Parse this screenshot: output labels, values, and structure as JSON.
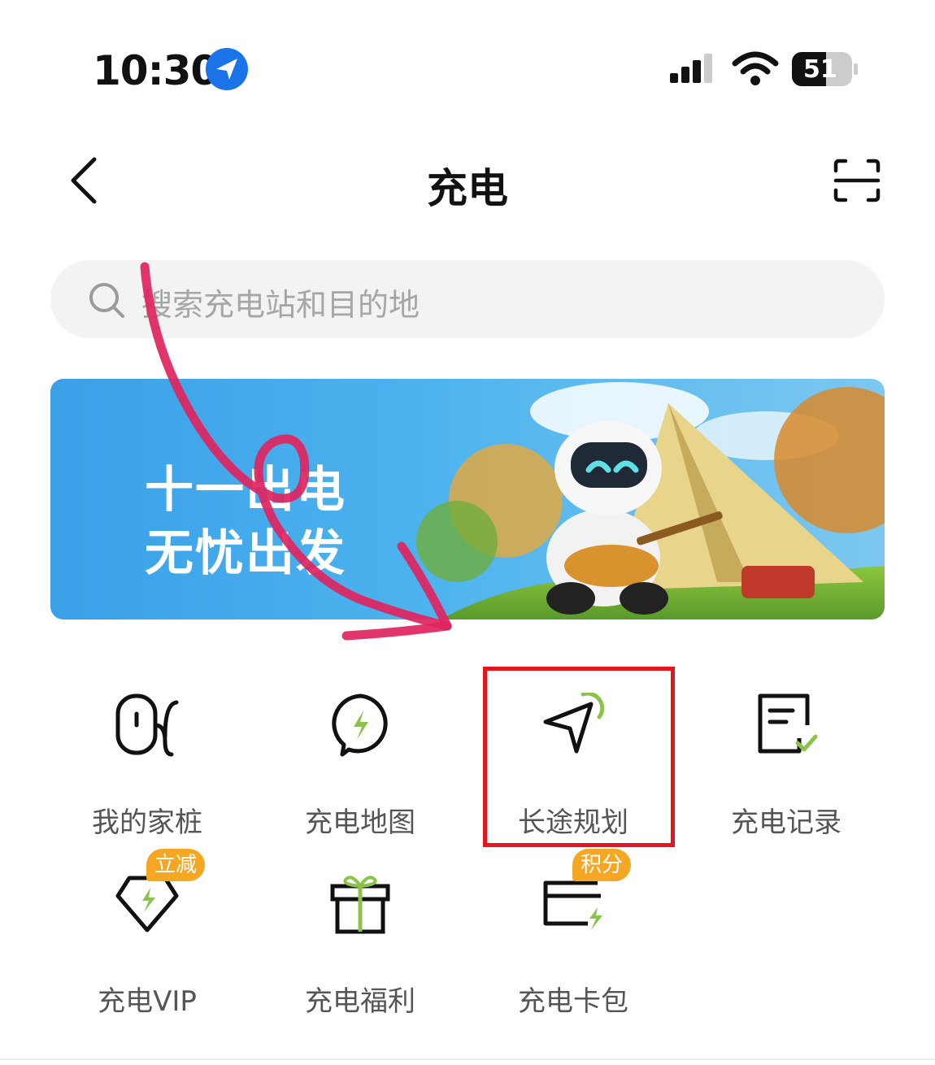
{
  "status": {
    "time": "10:30",
    "battery": "51"
  },
  "nav": {
    "title": "充电"
  },
  "search": {
    "placeholder": "搜索充电站和目的地"
  },
  "banner": {
    "line1": "十一出电",
    "line2": "无忧出发"
  },
  "grid": [
    {
      "label": "我的家桩",
      "icon": "home-charger-icon"
    },
    {
      "label": "充电地图",
      "icon": "charging-map-icon"
    },
    {
      "label": "长途规划",
      "icon": "route-planning-icon"
    },
    {
      "label": "充电记录",
      "icon": "charging-record-icon"
    },
    {
      "label": "充电VIP",
      "icon": "vip-diamond-icon",
      "badge": "立减"
    },
    {
      "label": "充电福利",
      "icon": "gift-icon"
    },
    {
      "label": "充电卡包",
      "icon": "card-wallet-icon",
      "badge": "积分"
    }
  ],
  "colors": {
    "accent_green": "#8bc34a",
    "badge_orange": "#f5a623",
    "highlight_red": "#e8141b",
    "annotation_pink": "#e0245e"
  }
}
